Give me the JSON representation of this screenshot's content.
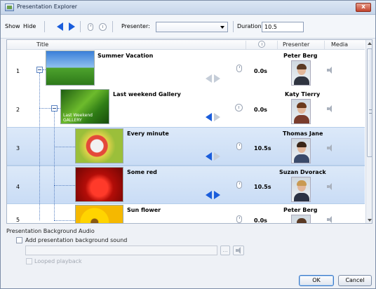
{
  "window": {
    "title": "Presentation Explorer",
    "close_label": "x"
  },
  "toolbar": {
    "show_label": "Show",
    "hide_label": "Hide",
    "presenter_label": "Presenter:",
    "presenter_value": "",
    "duration_label": "Duration:",
    "duration_value": "10.5"
  },
  "list": {
    "headers": {
      "title": "Title",
      "presenter": "Presenter",
      "media": "Media"
    },
    "rows": [
      {
        "num": "1",
        "title": "Summer Vacation",
        "duration": "0.0s",
        "presenter": "Peter Berg",
        "selected": false
      },
      {
        "num": "2",
        "title": "Last weekend Gallery",
        "duration": "0.0s",
        "presenter": "Katy Tierry",
        "selected": false,
        "thumb_caption": "Last Weekend GALLERY"
      },
      {
        "num": "3",
        "title": "Every minute",
        "duration": "10.5s",
        "presenter": "Thomas Jane",
        "selected": true
      },
      {
        "num": "4",
        "title": "Some red",
        "duration": "10.5s",
        "presenter": "Suzan Dvorack",
        "selected": true
      },
      {
        "num": "5",
        "title": "Sun flower",
        "duration": "0.0s",
        "presenter": "Peter Berg",
        "selected": false
      }
    ]
  },
  "bottom": {
    "section_title": "Presentation Background Audio",
    "add_sound_label": "Add presentation background sound",
    "browse_label": "...",
    "looped_label": "Looped playback",
    "ok_label": "OK",
    "cancel_label": "Cancel"
  },
  "colors": {
    "accent": "#1a5ddb",
    "selection": "#c9dcf5",
    "window_bg": "#eef1f6"
  }
}
